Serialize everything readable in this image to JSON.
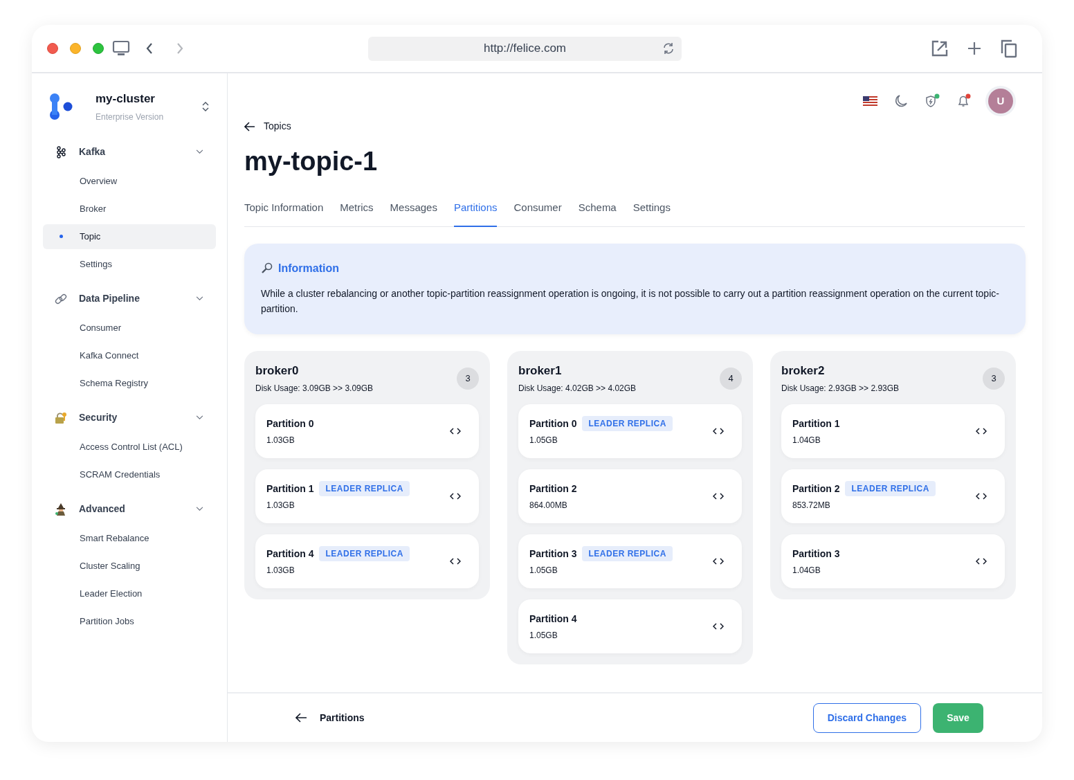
{
  "browser": {
    "url": "http://felice.com"
  },
  "sidebar": {
    "cluster": {
      "name": "my-cluster",
      "subtitle": "Enterprise Version"
    },
    "groups": [
      {
        "label": "Kafka",
        "items": [
          {
            "label": "Overview",
            "selected": false
          },
          {
            "label": "Broker",
            "selected": false
          },
          {
            "label": "Topic",
            "selected": true
          },
          {
            "label": "Settings",
            "selected": false
          }
        ]
      },
      {
        "label": "Data Pipeline",
        "items": [
          {
            "label": "Consumer",
            "selected": false
          },
          {
            "label": "Kafka Connect",
            "selected": false
          },
          {
            "label": "Schema Registry",
            "selected": false
          }
        ]
      },
      {
        "label": "Security",
        "items": [
          {
            "label": "Access Control List (ACL)",
            "selected": false
          },
          {
            "label": "SCRAM Credentials",
            "selected": false
          }
        ]
      },
      {
        "label": "Advanced",
        "items": [
          {
            "label": "Smart Rebalance",
            "selected": false
          },
          {
            "label": "Cluster Scaling",
            "selected": false
          },
          {
            "label": "Leader Election",
            "selected": false
          },
          {
            "label": "Partition Jobs",
            "selected": false
          }
        ]
      }
    ]
  },
  "header": {
    "avatar": "U"
  },
  "breadcrumb": "Topics",
  "title": "my-topic-1",
  "tabs": [
    {
      "label": "Topic Information",
      "selected": false
    },
    {
      "label": "Metrics",
      "selected": false
    },
    {
      "label": "Messages",
      "selected": false
    },
    {
      "label": "Partitions",
      "selected": true
    },
    {
      "label": "Consumer",
      "selected": false
    },
    {
      "label": "Schema",
      "selected": false
    },
    {
      "label": "Settings",
      "selected": false
    }
  ],
  "info": {
    "title": "Information",
    "text": "While a cluster rebalancing or another topic-partition reassignment operation is ongoing, it is not possible to carry out a partition reassignment operation on the current topic-partition."
  },
  "brokers": [
    {
      "name": "broker0",
      "disk_usage": "Disk Usage: 3.09GB >> 3.09GB",
      "count": "3",
      "partitions": [
        {
          "name": "Partition 0",
          "size": "1.03GB"
        },
        {
          "name": "Partition 1",
          "size": "1.03GB",
          "badge": "LEADER REPLICA"
        },
        {
          "name": "Partition 4",
          "size": "1.03GB",
          "badge": "LEADER REPLICA"
        }
      ]
    },
    {
      "name": "broker1",
      "disk_usage": "Disk Usage: 4.02GB >> 4.02GB",
      "count": "4",
      "partitions": [
        {
          "name": "Partition 0",
          "size": "1.05GB",
          "badge": "LEADER REPLICA"
        },
        {
          "name": "Partition 2",
          "size": "864.00MB"
        },
        {
          "name": "Partition 3",
          "size": "1.05GB",
          "badge": "LEADER REPLICA"
        },
        {
          "name": "Partition 4",
          "size": "1.05GB"
        }
      ]
    },
    {
      "name": "broker2",
      "disk_usage": "Disk Usage: 2.93GB >> 2.93GB",
      "count": "3",
      "partitions": [
        {
          "name": "Partition 1",
          "size": "1.04GB"
        },
        {
          "name": "Partition 2",
          "size": "853.72MB",
          "badge": "LEADER REPLICA"
        },
        {
          "name": "Partition 3",
          "size": "1.04GB"
        }
      ]
    }
  ],
  "footer": {
    "back_label": "Partitions",
    "discard": "Discard Changes",
    "save": "Save"
  }
}
